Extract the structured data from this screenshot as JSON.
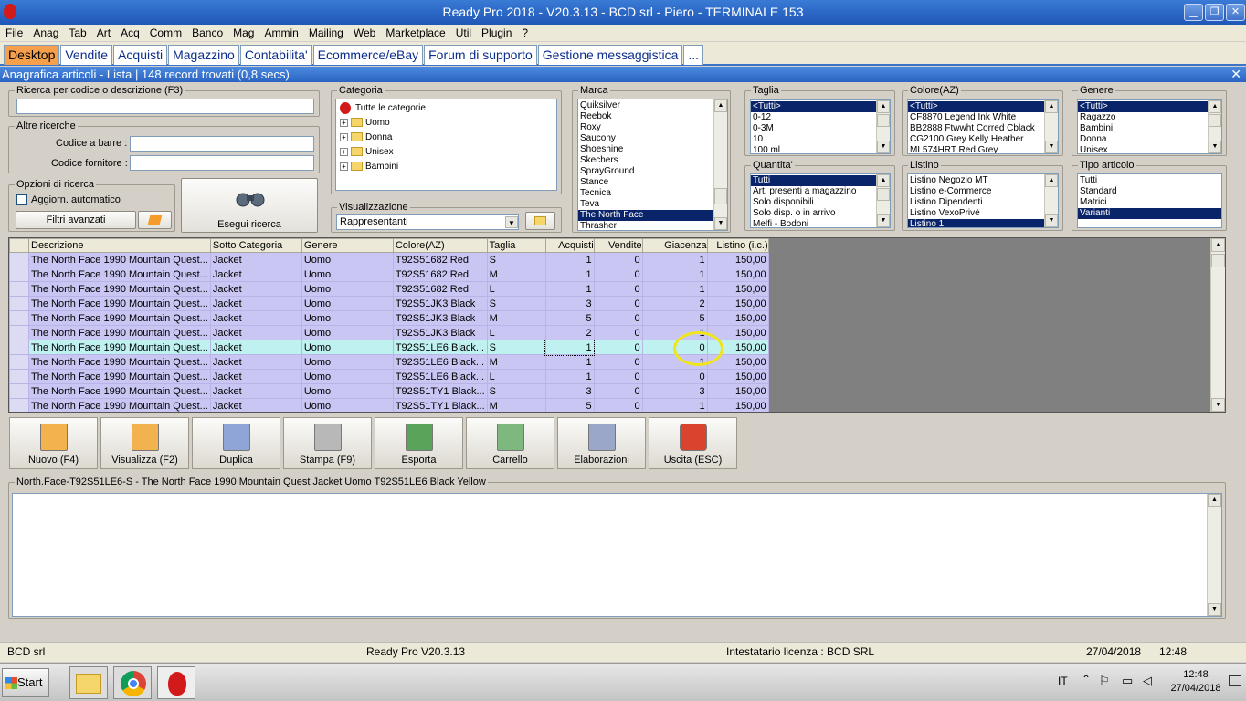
{
  "window": {
    "title": "Ready Pro 2018 - V20.3.13 - BCD srl - Piero - TERMINALE 153"
  },
  "menu": [
    "File",
    "Anag",
    "Tab",
    "Art",
    "Acq",
    "Comm",
    "Banco",
    "Mag",
    "Ammin",
    "Mailing",
    "Web",
    "Marketplace",
    "Util",
    "Plugin",
    "?"
  ],
  "tabs": [
    "Desktop",
    "Vendite",
    "Acquisti",
    "Magazzino",
    "Contabilita'",
    "Ecommerce/eBay",
    "Forum di supporto",
    "Gestione messaggistica",
    "..."
  ],
  "section": {
    "title": "Anagrafica articoli  - Lista | 148 record trovati (0,8 secs)"
  },
  "search": {
    "code_label": "Ricerca per codice o descrizione (F3)",
    "altre_label": "Altre ricerche",
    "barcode_label": "Codice a barre :",
    "supplier_label": "Codice fornitore :",
    "options_label": "Opzioni di ricerca",
    "auto_label": "Aggiorn. automatico",
    "advanced_label": "Filtri avanzati",
    "execute_label": "Esegui ricerca"
  },
  "categoria": {
    "label": "Categoria",
    "root": "Tutte le categorie",
    "items": [
      "Uomo",
      "Donna",
      "Unisex",
      "Bambini"
    ]
  },
  "visualizzazione": {
    "label": "Visualizzazione",
    "value": "Rappresentanti"
  },
  "marca": {
    "label": "Marca",
    "items": [
      "Quiksilver",
      "Reebok",
      "Roxy",
      "Saucony",
      "Shoeshine",
      "Skechers",
      "SprayGround",
      "Stance",
      "Tecnica",
      "Teva",
      "The North Face",
      "Thrasher"
    ],
    "selected": 10
  },
  "taglia": {
    "label": "Taglia",
    "items": [
      "<Tutti>",
      "0-12",
      "0-3M",
      "10",
      "100 ml"
    ],
    "selected": 0
  },
  "colore": {
    "label": "Colore(AZ)",
    "items": [
      "<Tutti>",
      "CF8870 Legend Ink White",
      "BB2888 Ftwwht Corred Cblack",
      "CG2100 Grey Kelly Heather",
      "ML574HRT Red Grey"
    ],
    "selected": 0
  },
  "genere": {
    "label": "Genere",
    "items": [
      "<Tutti>",
      "Ragazzo",
      "Bambini",
      "Donna",
      "Unisex"
    ],
    "selected": 0
  },
  "quantita": {
    "label": "Quantita'",
    "items": [
      "Tutti",
      "Art. presenti a magazzino",
      "Solo disponibili",
      "Solo disp. o in arrivo",
      "Melfi - Bodoni"
    ],
    "selected": 0
  },
  "listino": {
    "label": "Listino",
    "items": [
      "Listino Negozio MT",
      "Listino e-Commerce",
      "Listino Dipendenti",
      "Listino VexoPrivè",
      "Listino 1"
    ],
    "selected": 4
  },
  "tipo": {
    "label": "Tipo articolo",
    "items": [
      "Tutti",
      "Standard",
      "Matrici",
      "Varianti"
    ],
    "selected": 3
  },
  "grid": {
    "columns": [
      "Descrizione",
      "Sotto Categoria",
      "Genere",
      "Colore(AZ)",
      "Taglia",
      "Acquisti",
      "Vendite",
      "Giacenza",
      "Listino (i.c.)"
    ],
    "rows": [
      [
        "The North Face 1990 Mountain Quest...",
        "Jacket",
        "Uomo",
        "T92S51682 Red",
        "S",
        "1",
        "0",
        "1",
        "150,00"
      ],
      [
        "The North Face 1990 Mountain Quest...",
        "Jacket",
        "Uomo",
        "T92S51682 Red",
        "M",
        "1",
        "0",
        "1",
        "150,00"
      ],
      [
        "The North Face 1990 Mountain Quest...",
        "Jacket",
        "Uomo",
        "T92S51682 Red",
        "L",
        "1",
        "0",
        "1",
        "150,00"
      ],
      [
        "The North Face 1990 Mountain Quest...",
        "Jacket",
        "Uomo",
        "T92S51JK3 Black",
        "S",
        "3",
        "0",
        "2",
        "150,00"
      ],
      [
        "The North Face 1990 Mountain Quest...",
        "Jacket",
        "Uomo",
        "T92S51JK3 Black",
        "M",
        "5",
        "0",
        "5",
        "150,00"
      ],
      [
        "The North Face 1990 Mountain Quest...",
        "Jacket",
        "Uomo",
        "T92S51JK3 Black",
        "L",
        "2",
        "0",
        "1",
        "150,00"
      ],
      [
        "The North Face 1990 Mountain Quest...",
        "Jacket",
        "Uomo",
        "T92S51LE6 Black...",
        "S",
        "1",
        "0",
        "0",
        "150,00"
      ],
      [
        "The North Face 1990 Mountain Quest...",
        "Jacket",
        "Uomo",
        "T92S51LE6 Black...",
        "M",
        "1",
        "0",
        "1",
        "150,00"
      ],
      [
        "The North Face 1990 Mountain Quest...",
        "Jacket",
        "Uomo",
        "T92S51LE6 Black...",
        "L",
        "1",
        "0",
        "0",
        "150,00"
      ],
      [
        "The North Face 1990 Mountain Quest...",
        "Jacket",
        "Uomo",
        "T92S51TY1 Black...",
        "S",
        "3",
        "0",
        "3",
        "150,00"
      ],
      [
        "The North Face 1990 Mountain Quest...",
        "Jacket",
        "Uomo",
        "T92S51TY1 Black...",
        "M",
        "5",
        "0",
        "1",
        "150,00"
      ]
    ],
    "current_row": 6
  },
  "actions": [
    "Nuovo (F4)",
    "Visualizza (F2)",
    "Duplica",
    "Stampa (F9)",
    "Esporta",
    "Carrello",
    "Elaborazioni",
    "Uscita (ESC)"
  ],
  "detail": {
    "label": "North.Face-T92S51LE6-S - The North Face 1990 Mountain Quest Jacket Uomo T92S51LE6 Black Yellow"
  },
  "status": {
    "company": "BCD srl",
    "version": "Ready Pro V20.3.13",
    "license": "Intestatario licenza : BCD SRL",
    "date": "27/04/2018",
    "time": "12:48"
  },
  "taskbar": {
    "start": "Start",
    "lang": "IT",
    "clock_time": "12:48",
    "clock_date": "27/04/2018"
  }
}
